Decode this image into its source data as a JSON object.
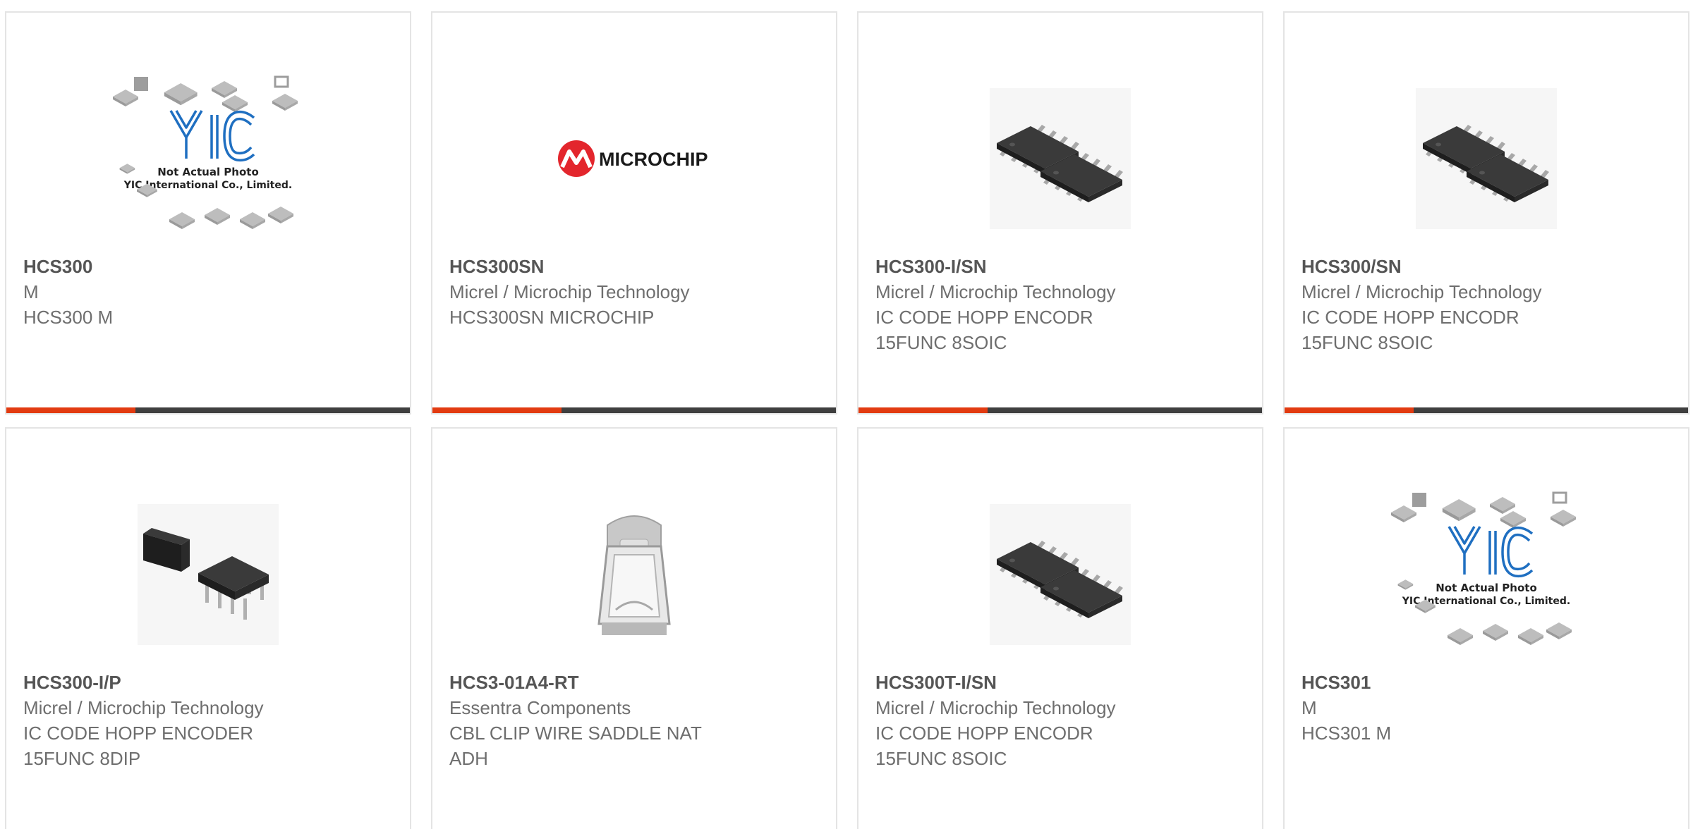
{
  "colors": {
    "accent": "#e23b11",
    "bar": "#3f3f3f",
    "border": "#e4e4e4",
    "title": "#555555",
    "text": "#6e6e6e"
  },
  "products": [
    {
      "part_number": "HCS300",
      "manufacturer": "M",
      "description": "HCS300 M",
      "image": "placeholder-photo-icon",
      "placeholder_line1": "Not Actual Photo",
      "placeholder_line2": "YIC International Co., Limited.",
      "logo_text": "YIC"
    },
    {
      "part_number": "HCS300SN",
      "manufacturer": "Micrel / Microchip Technology",
      "description": "HCS300SN MICROCHIP",
      "image": "microchip-logo-icon",
      "logo_text": "MICROCHIP"
    },
    {
      "part_number": "HCS300-I/SN",
      "manufacturer": "Micrel / Microchip Technology",
      "description": "IC CODE HOPP ENCODR\n15FUNC 8SOIC",
      "image": "soic8-chip-icon"
    },
    {
      "part_number": "HCS300/SN",
      "manufacturer": "Micrel / Microchip Technology",
      "description": "IC CODE HOPP ENCODR\n15FUNC 8SOIC",
      "image": "soic8-chip-icon"
    },
    {
      "part_number": "HCS300-I/P",
      "manufacturer": "Micrel / Microchip Technology",
      "description": "IC CODE HOPP ENCODER\n15FUNC 8DIP",
      "image": "dip8-chip-icon"
    },
    {
      "part_number": "HCS3-01A4-RT",
      "manufacturer": "Essentra Components",
      "description": "CBL CLIP WIRE SADDLE NAT\nADH",
      "image": "cable-clip-icon"
    },
    {
      "part_number": "HCS300T-I/SN",
      "manufacturer": "Micrel / Microchip Technology",
      "description": "IC CODE HOPP ENCODR\n15FUNC 8SOIC",
      "image": "soic8-chip-icon"
    },
    {
      "part_number": "HCS301",
      "manufacturer": "M",
      "description": "HCS301 M",
      "image": "placeholder-photo-icon",
      "placeholder_line1": "Not Actual Photo",
      "placeholder_line2": "YIC International Co., Limited.",
      "logo_text": "YIC"
    }
  ]
}
